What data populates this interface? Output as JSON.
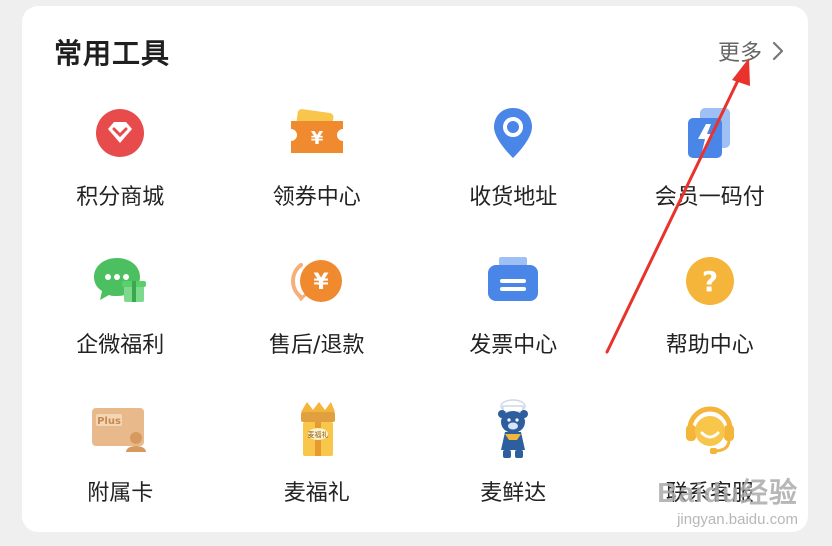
{
  "section": {
    "title": "常用工具",
    "more_label": "更多"
  },
  "tools": [
    [
      {
        "label": "积分商城",
        "icon": "points-mall-icon"
      },
      {
        "label": "领券中心",
        "icon": "coupon-icon"
      },
      {
        "label": "收货地址",
        "icon": "location-pin-icon"
      },
      {
        "label": "会员一码付",
        "icon": "member-pay-icon"
      }
    ],
    [
      {
        "label": "企微福利",
        "icon": "wechat-gift-icon"
      },
      {
        "label": "售后/退款",
        "icon": "refund-icon"
      },
      {
        "label": "发票中心",
        "icon": "invoice-icon"
      },
      {
        "label": "帮助中心",
        "icon": "help-icon"
      }
    ],
    [
      {
        "label": "附属卡",
        "icon": "plus-card-icon"
      },
      {
        "label": "麦福礼",
        "icon": "gift-box-icon"
      },
      {
        "label": "麦鲜达",
        "icon": "bear-mascot-icon"
      },
      {
        "label": "联系客服",
        "icon": "customer-service-icon"
      }
    ]
  ],
  "watermark": {
    "main": "Baidu经验",
    "sub": "jingyan.baidu.com"
  },
  "colors": {
    "annotation_arrow": "#e8322b",
    "red": "#e84b4b",
    "orange": "#f08a2e",
    "blue": "#4a86e8",
    "green": "#4cbf60",
    "yellow": "#f5b43a"
  }
}
